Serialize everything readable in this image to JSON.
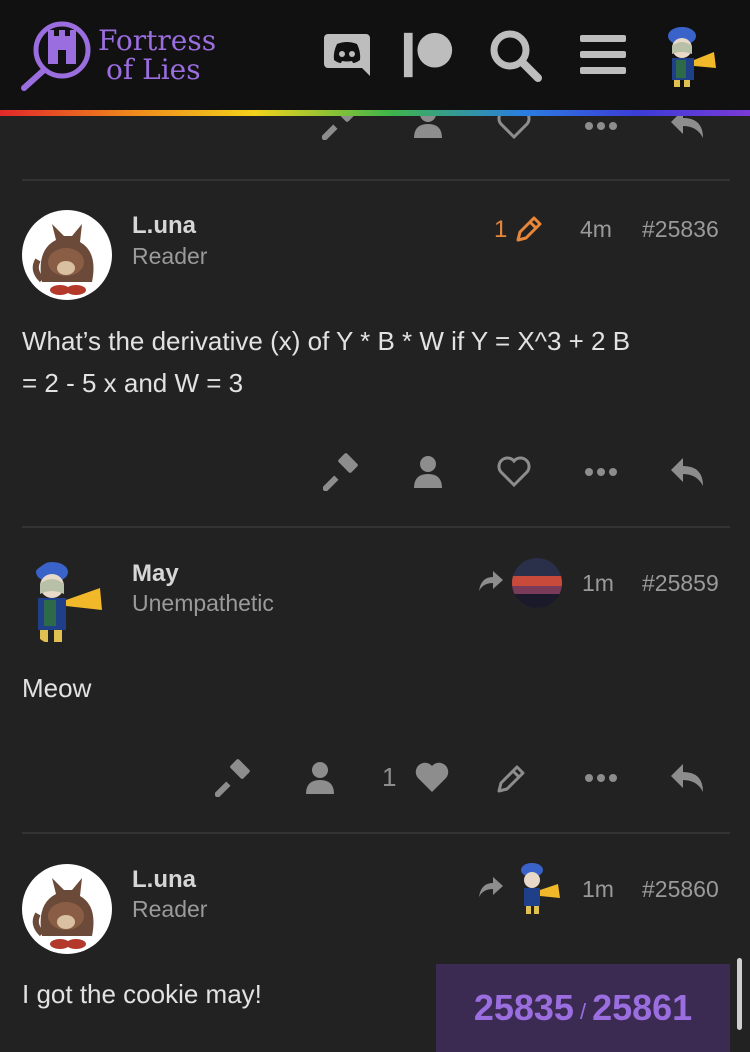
{
  "site": {
    "name_line1": "Fortress",
    "name_line2": "of Lies"
  },
  "colors": {
    "accent": "#9b6ee0",
    "edit": "#e8873a",
    "background": "#222222"
  },
  "header_icons": [
    "discord-icon",
    "patreon-icon",
    "search-icon",
    "menu-icon",
    "user-avatar"
  ],
  "posts": [
    {
      "username": "L.una",
      "role": "Reader",
      "edit_count": "1",
      "time": "4m",
      "number": "#25836",
      "body_line1": "What’s the derivative (x) of Y * B * W if Y = X^3 + 2 B",
      "body_line2": "= 2 - 5 x and W = 3"
    },
    {
      "username": "May",
      "role": "Unempathetic",
      "time": "1m",
      "number": "#25859",
      "body_line1": "Meow",
      "like_count": "1"
    },
    {
      "username": "L.una",
      "role": "Reader",
      "time": "1m",
      "number": "#25860",
      "body_line1": "I got the cookie may!"
    }
  ],
  "progress": {
    "current": "25835",
    "separator": "/",
    "total": "25861"
  }
}
